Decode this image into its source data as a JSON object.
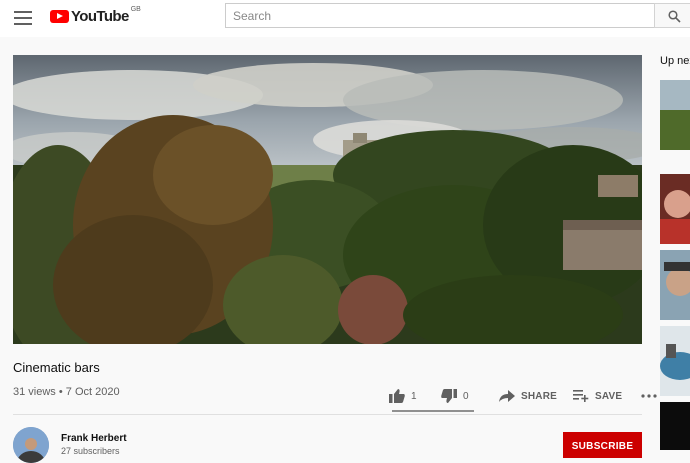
{
  "header": {
    "logo_text": "YouTube",
    "country_code": "GB",
    "search_placeholder": "Search"
  },
  "video": {
    "title": "Cinematic bars",
    "views": "31 views",
    "date": "7 Oct 2020",
    "likes": "1",
    "dislikes": "0",
    "share_label": "SHARE",
    "save_label": "SAVE"
  },
  "channel": {
    "name": "Frank Herbert",
    "subscribers": "27 subscribers",
    "subscribe_label": "SUBSCRIBE"
  },
  "sidebar": {
    "heading": "Up next"
  },
  "colors": {
    "brand_red": "#ff0000",
    "subscribe_red": "#cc0000",
    "secondary_text": "#606060"
  }
}
